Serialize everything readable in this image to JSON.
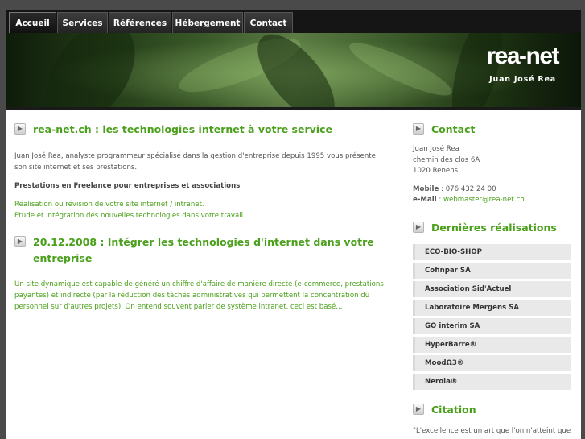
{
  "nav": {
    "tabs": [
      {
        "label": "Accueil"
      },
      {
        "label": "Services"
      },
      {
        "label": "Références"
      },
      {
        "label": "Hébergement"
      },
      {
        "label": "Contact"
      }
    ]
  },
  "banner": {
    "logo": "rea-net",
    "owner": "Juan José Rea"
  },
  "main": {
    "intro_title": "rea-net.ch : les technologies internet à votre service",
    "intro_text": "Juan José Rea, analyste programmeur spécialisé dans la gestion d'entreprise depuis 1995 vous présente son site internet et ses prestations.",
    "freelance_heading": "Prestations en Freelance pour entreprises et associations",
    "freelance_line1": "Réalisation ou révision de votre site internet / intranet.",
    "freelance_line2": "Etude et intégration des nouvelles technologies dans votre travail.",
    "news_title": "20.12.2008 : Intégrer les technologies d'internet dans votre entreprise",
    "news_text": "Un site dynamique est capable de généré un chiffre d'affaire de manière directe (e-commerce, prestations payantes) et indirecte (par la réduction des tâches administratives qui permettent la concentration du personnel sur d'autres projets). On entend souvent parler de système intranet, ceci est basé..."
  },
  "sidebar": {
    "contact_title": "Contact",
    "name": "Juan José Rea",
    "street": "chemin des clos 6A",
    "city": "1020 Renens",
    "mobile_label": "Mobile",
    "mobile": ": 076 432 24 00",
    "email_label": "e-Mail",
    "email_sep": ":",
    "email": "webmaster@rea-net.ch",
    "realisations_title": "Dernières réalisations",
    "realisations": [
      "ECO-BIO-SHOP",
      "Cofinpar SA",
      "Association Sid'Actuel",
      "Laboratoire Mergens SA",
      "GO interim SA",
      "HyperBarre®",
      "MoodΩ3®",
      "Nerola®"
    ],
    "citation_title": "Citation",
    "citation_text": "\"L'excellence est un art que l'on n'atteint que"
  },
  "icons": {
    "heading_arrow": "chevron-right-icon"
  },
  "colors": {
    "accent": "#4aa01a",
    "nav_bg": "#151515",
    "page_bg": "#4a4a4a"
  }
}
